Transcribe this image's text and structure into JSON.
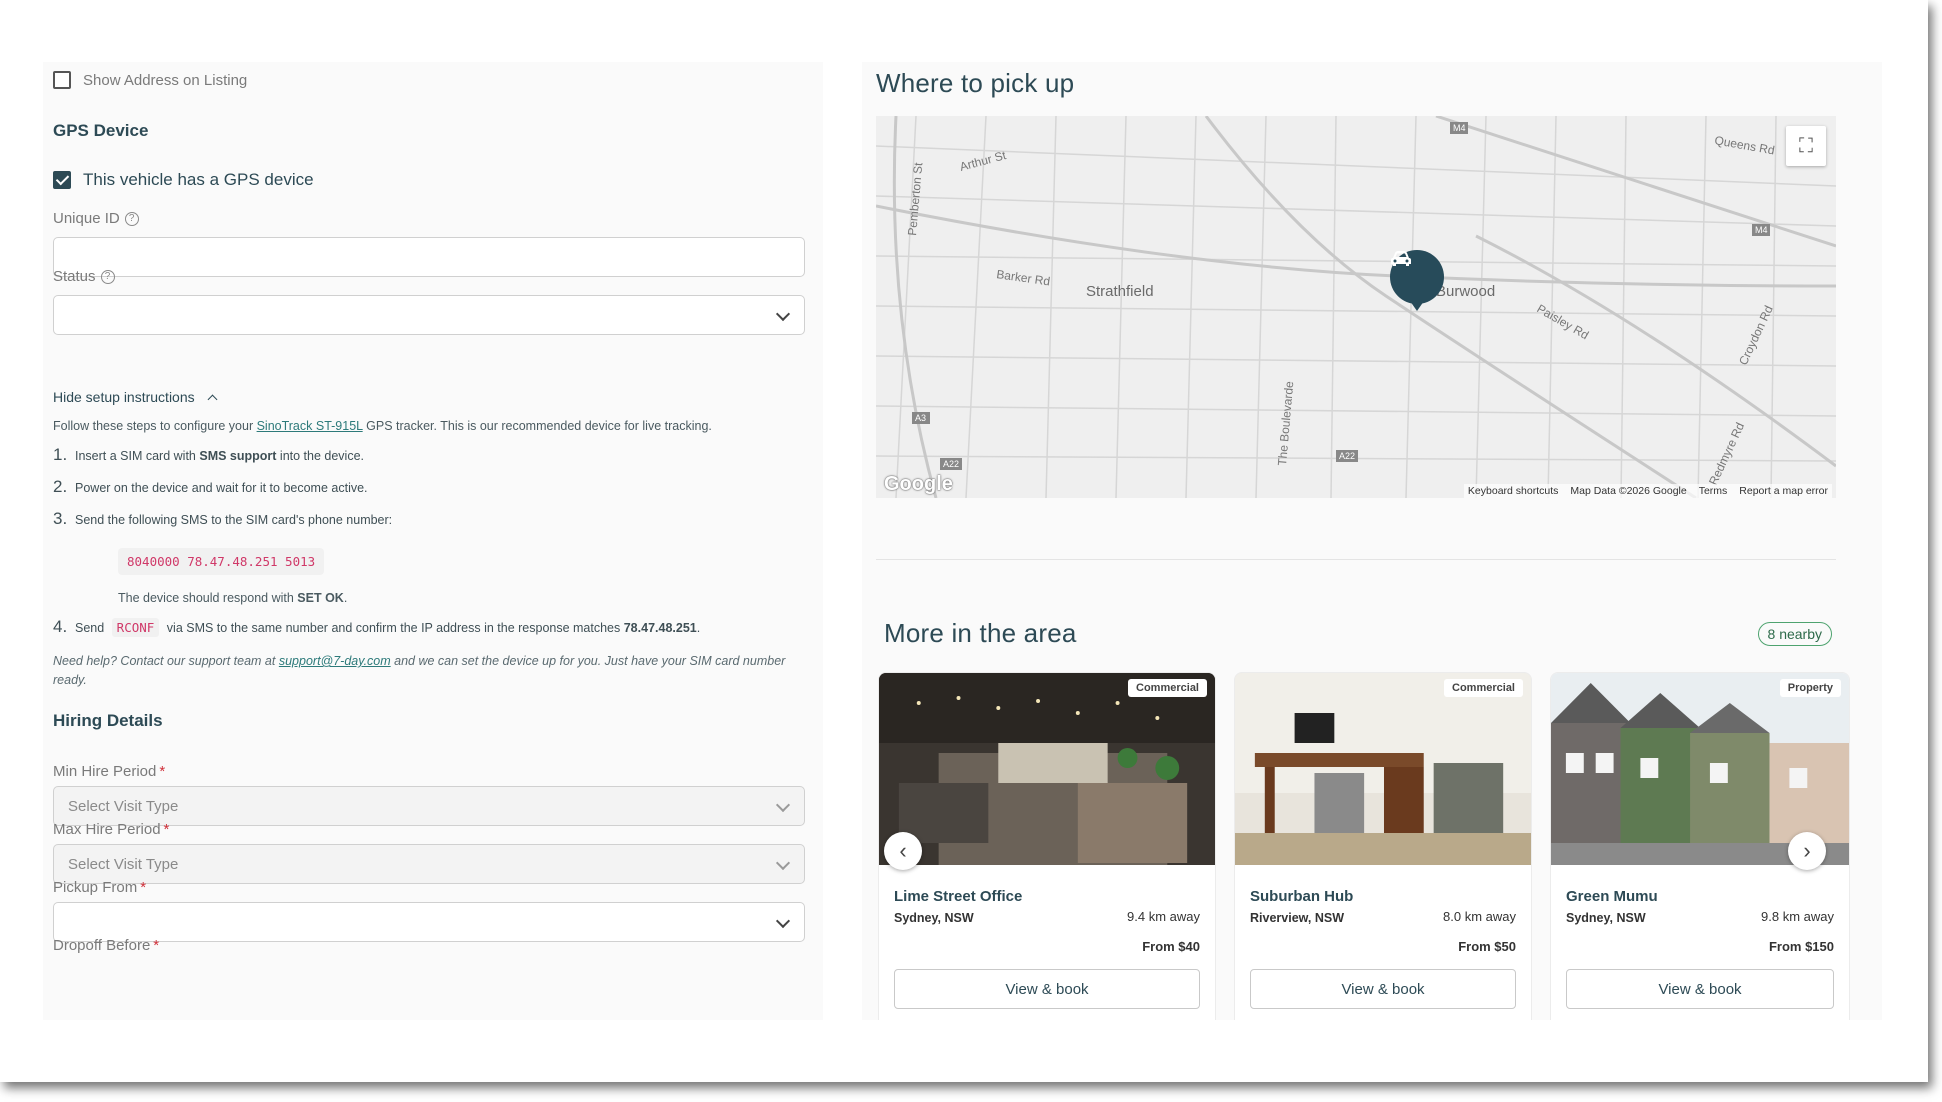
{
  "listing": {
    "show_address_label": "Show Address on Listing",
    "show_address_checked": false
  },
  "gps": {
    "section_title": "GPS Device",
    "has_gps_label": "This vehicle has a GPS device",
    "has_gps_checked": true,
    "unique_id_label": "Unique ID",
    "unique_id_value": "",
    "status_label": "Status",
    "status_value": "",
    "toggle_label": "Hide setup instructions",
    "intro_before": "Follow these steps to configure your ",
    "intro_link": "SinoTrack ST-915L",
    "intro_after": " GPS tracker. This is our recommended device for live tracking.",
    "steps": [
      {
        "num": "1.",
        "pre": "Insert a SIM card with ",
        "bold": "SMS support",
        "post": " into the device."
      },
      {
        "num": "2.",
        "text": "Power on the device and wait for it to become active."
      },
      {
        "num": "3.",
        "text": "Send the following SMS to the SIM card's phone number:"
      },
      {
        "num": "4.",
        "pre": "Send ",
        "code": "RCONF",
        "mid": " via SMS to the same number and confirm the IP address in the response matches ",
        "bold": "78.47.48.251",
        "post": "."
      }
    ],
    "sms_code": "8040000 78.47.48.251 5013",
    "respond_pre": "The device should respond with ",
    "respond_bold": "SET OK",
    "respond_post": ".",
    "help_pre": "Need help? Contact our support team at ",
    "help_link": "support@7-day.com",
    "help_post": " and we can set the device up for you. Just have your SIM card number ready."
  },
  "hiring": {
    "section_title": "Hiring Details",
    "min_label": "Min Hire Period",
    "min_placeholder": "Select Visit Type",
    "max_label": "Max Hire Period",
    "max_placeholder": "Select Visit Type",
    "pickup_label": "Pickup From",
    "pickup_value": "",
    "dropoff_label": "Dropoff Before",
    "required_mark": "*"
  },
  "map": {
    "title": "Where to pick up",
    "fullscreen_icon": "expand-icon",
    "labels": [
      "Strathfield",
      "Burwood",
      "Arthur St",
      "Barker Rd",
      "Pemberton St",
      "Queens Rd",
      "Paisley Rd",
      "Croydon Rd",
      "The Boulevarde",
      "Redmyre Rd",
      "A3",
      "A22",
      "M4"
    ],
    "google": "Google",
    "footer": [
      "Keyboard shortcuts",
      "Map Data ©2026 Google",
      "Terms",
      "Report a map error"
    ],
    "marker_icon": "car-icon"
  },
  "nearby": {
    "title": "More in the area",
    "badge": "8 nearby",
    "cards": [
      {
        "tag": "Commercial",
        "name": "Lime Street Office",
        "location": "Sydney, NSW",
        "distance": "9.4 km away",
        "price": "From $40",
        "button": "View & book"
      },
      {
        "tag": "Commercial",
        "name": "Suburban Hub",
        "location": "Riverview, NSW",
        "distance": "8.0 km away",
        "price": "From $50",
        "button": "View & book"
      },
      {
        "tag": "Property",
        "name": "Green Mumu",
        "location": "Sydney, NSW",
        "distance": "9.8 km away",
        "price": "From $150",
        "button": "View & book"
      }
    ],
    "prev_icon": "chevron-left-icon",
    "next_icon": "chevron-right-icon"
  }
}
